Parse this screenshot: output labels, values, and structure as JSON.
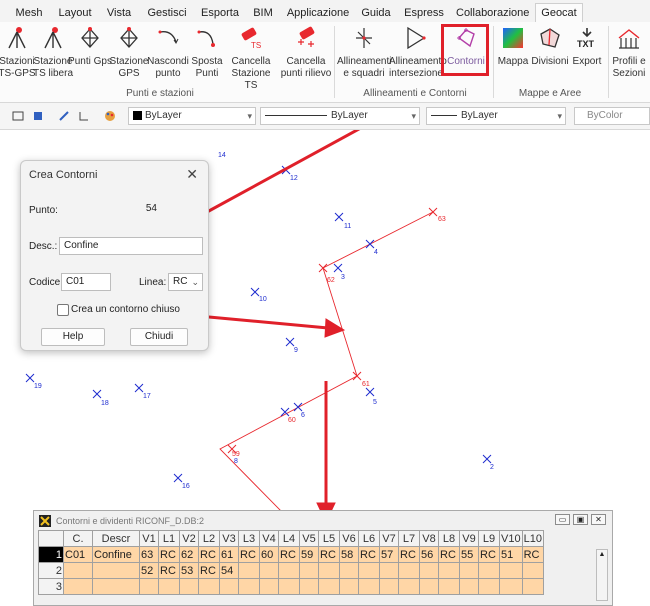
{
  "ribbon": {
    "tabs": [
      "Mesh",
      "Layout",
      "Vista",
      "Gestisci",
      "Esporta",
      "BIM",
      "Applicazione",
      "Guida",
      "Espress",
      "Collaborazione",
      "Geocat"
    ],
    "active_tab": "Geocat",
    "buttons": [
      {
        "label": "Stazioni TS-GPS",
        "icon": "tripod-icon"
      },
      {
        "label": "Stazione TS libera",
        "icon": "tripod-icon"
      },
      {
        "label": "Punti Gps",
        "icon": "gps-icon"
      },
      {
        "label": "Stazione GPS",
        "icon": "gps-icon"
      },
      {
        "label": "Nascondi punto",
        "icon": "hide-point-icon"
      },
      {
        "label": "Sposta Punti",
        "icon": "move-points-icon"
      },
      {
        "label": "Cancella Stazione TS",
        "icon": "eraser-icon"
      },
      {
        "label": "Cancella punti rilievo",
        "icon": "eraser-icon"
      },
      {
        "label": "Allineamenti e squadri",
        "icon": "alignment-icon"
      },
      {
        "label": "Allineamento intersezione",
        "icon": "intersection-icon"
      },
      {
        "label": "Contorni",
        "icon": "contour-icon"
      },
      {
        "label": "Mappa",
        "icon": "map-icon"
      },
      {
        "label": "Divisioni",
        "icon": "divisions-icon"
      },
      {
        "label": "Export",
        "icon": "txt-export-icon"
      },
      {
        "label": "Profili e Sezioni",
        "icon": "profile-icon"
      }
    ],
    "groups": [
      "Punti e stazioni",
      "Allineamenti e Contorni",
      "Mappe e Aree"
    ]
  },
  "properties_bar": {
    "color": "ByLayer",
    "linetype": "ByLayer",
    "lineweight": "ByLayer",
    "plotstyle": "ByColor"
  },
  "dialog": {
    "title": "Crea Contorni",
    "punto_label": "Punto:",
    "punto_value": "54",
    "desc_label": "Desc.:",
    "desc_value": "Confine",
    "codice_label": "Codice:",
    "codice_value": "C01",
    "linea_label": "Linea:",
    "linea_value": "RC",
    "checkbox_label": "Crea un contorno chiuso",
    "help_label": "Help",
    "close_label": "Chiudi"
  },
  "drawing": {
    "points": [
      {
        "label": "14"
      },
      {
        "label": "12"
      },
      {
        "label": "11"
      },
      {
        "label": "4"
      },
      {
        "label": "3"
      },
      {
        "label": "10"
      },
      {
        "label": "9"
      },
      {
        "label": "5"
      },
      {
        "label": "6"
      },
      {
        "label": "8"
      },
      {
        "label": "19"
      },
      {
        "label": "18"
      },
      {
        "label": "17"
      },
      {
        "label": "16"
      },
      {
        "label": "2"
      }
    ],
    "contour_points": [
      {
        "label": "63"
      },
      {
        "label": "62"
      },
      {
        "label": "61"
      },
      {
        "label": "60"
      },
      {
        "label": "59"
      }
    ],
    "colors": {
      "point": "#1e2ccf",
      "contour": "#e8282e",
      "arrow": "#e0202a"
    }
  },
  "grid": {
    "title": "Contorni e dividenti RICONF_D.DB:2",
    "columns": [
      "C.",
      "Descr",
      "V1",
      "L1",
      "V2",
      "L2",
      "V3",
      "L3",
      "V4",
      "L4",
      "V5",
      "L5",
      "V6",
      "L6",
      "V7",
      "L7",
      "V8",
      "L8",
      "V9",
      "L9",
      "V10",
      "L10"
    ],
    "rows": [
      {
        "num": "1",
        "cells": [
          "C01",
          "Confine",
          "63",
          "RC",
          "62",
          "RC",
          "61",
          "RC",
          "60",
          "RC",
          "59",
          "RC",
          "58",
          "RC",
          "57",
          "RC",
          "56",
          "RC",
          "55",
          "RC",
          "51",
          "RC"
        ]
      },
      {
        "num": "2",
        "cells": [
          "",
          "",
          "52",
          "RC",
          "53",
          "RC",
          "54",
          "",
          "",
          "",
          "",
          "",
          "",
          "",
          "",
          "",
          "",
          "",
          "",
          "",
          "",
          ""
        ]
      },
      {
        "num": "3",
        "cells": [
          "",
          "",
          "",
          "",
          "",
          "",
          "",
          "",
          "",
          "",
          "",
          "",
          "",
          "",
          "",
          "",
          "",
          "",
          "",
          "",
          "",
          ""
        ]
      }
    ]
  }
}
